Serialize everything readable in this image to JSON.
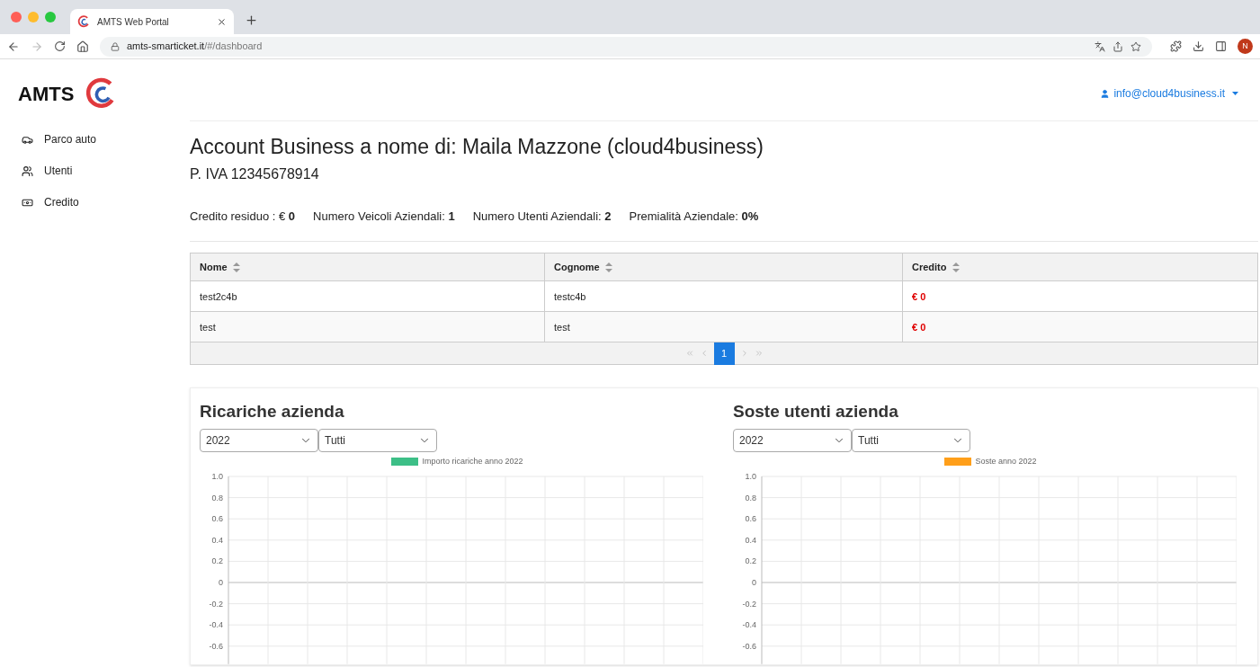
{
  "browser": {
    "tab_title": "AMTS Web Portal",
    "url_host": "amts-smarticket.it",
    "url_path": "/#/dashboard",
    "profile_initial": "N"
  },
  "header": {
    "logo_text": "AMTS",
    "user_email": "info@cloud4business.it"
  },
  "sidebar": {
    "items": [
      {
        "label": "Parco auto"
      },
      {
        "label": "Utenti"
      },
      {
        "label": "Credito"
      }
    ]
  },
  "account": {
    "title": "Account Business a nome di: Maila Mazzone (cloud4business)",
    "vat": "P. IVA 12345678914",
    "stats": [
      "Credito residuo : € **0**",
      "Numero Veicoli Aziendali: **1**",
      "Numero Utenti Aziendali: **2**",
      "Premialità Aziendale: **0%**"
    ]
  },
  "table": {
    "columns": [
      "Nome",
      "Cognome",
      "Credito"
    ],
    "rows": [
      [
        "test2c4b",
        "testc4b",
        "€ 0"
      ],
      [
        "test",
        "test",
        "€ 0"
      ]
    ],
    "pagination": {
      "pages": [
        {
          "label": "1",
          "selected": true
        }
      ]
    }
  },
  "charts": [
    {
      "title": "Ricariche azienda",
      "year": "2022",
      "filter": "Tutti",
      "chart_data": {
        "type": "bar",
        "series": [
          {
            "name": "Importo ricariche anno 2022",
            "color": "#3dbf87"
          }
        ],
        "grid": true,
        "ylim": [
          -0.6,
          1.0
        ],
        "yticks": [
          {
            "value": 1.0,
            "label": "1.0"
          },
          0.8,
          0.6,
          0.4,
          0.2,
          0,
          -0.2,
          -0.4,
          -0.6
        ]
      }
    },
    {
      "title": "Soste utenti azienda",
      "year": "2022",
      "filter": "Tutti",
      "chart_data": {
        "type": "bar",
        "series": [
          {
            "name": "Soste anno 2022",
            "color": "#ff9f1a"
          }
        ],
        "grid": true,
        "ylim": [
          -0.6,
          1.0
        ],
        "yticks": [
          {
            "value": 1.0,
            "label": "1.0"
          },
          0.8,
          0.6,
          0.4,
          0.2,
          0,
          -0.2,
          -0.4,
          -0.6
        ]
      }
    }
  ]
}
